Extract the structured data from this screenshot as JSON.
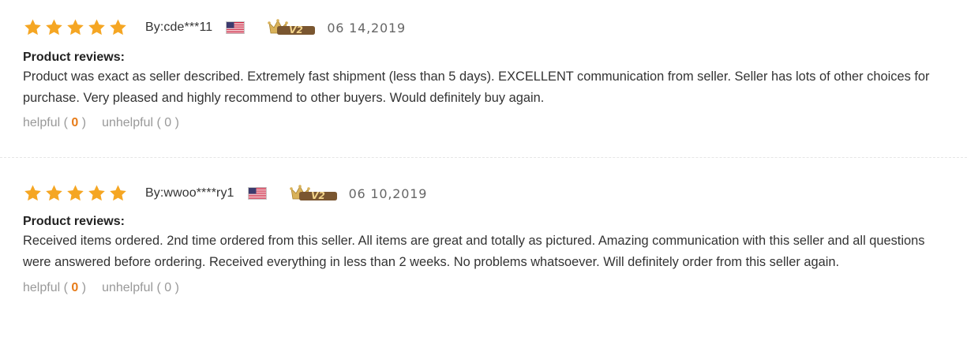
{
  "reviews": [
    {
      "rating": 5,
      "byline": "By:cde***11",
      "flag_icon": "us-flag-icon",
      "vip_level": "V2",
      "date": "06 14,2019",
      "label": "Product reviews:",
      "content": "Product was exact as seller described. Extremely fast shipment (less than 5 days). EXCELLENT communication from seller. Seller has lots of other choices for purchase. Very pleased and highly recommend to other buyers. Would definitely buy again.",
      "helpful": {
        "label": "helpful",
        "open": "(",
        "count": "0",
        "close": ")"
      },
      "unhelpful": {
        "label": "unhelpful",
        "open": "(",
        "count": "0",
        "close": ")"
      }
    },
    {
      "rating": 5,
      "byline": "By:wwoo****ry1",
      "flag_icon": "us-flag-icon",
      "vip_level": "V2",
      "date": "06 10,2019",
      "label": "Product reviews:",
      "content": "Received items ordered. 2nd time ordered from this seller. All items are great and totally as pictured. Amazing communication with this seller and all questions were answered before ordering. Received everything in less than 2 weeks. No problems whatsoever. Will definitely order from this seller again.",
      "helpful": {
        "label": "helpful",
        "open": "(",
        "count": "0",
        "close": ")"
      },
      "unhelpful": {
        "label": "unhelpful",
        "open": "(",
        "count": "0",
        "close": ")"
      }
    }
  ],
  "colors": {
    "star": "#f5a623",
    "helpful_count": "#e77c1a",
    "muted": "#999999",
    "vip_gold": "#c8a24a",
    "vip_brown": "#7a5630"
  }
}
